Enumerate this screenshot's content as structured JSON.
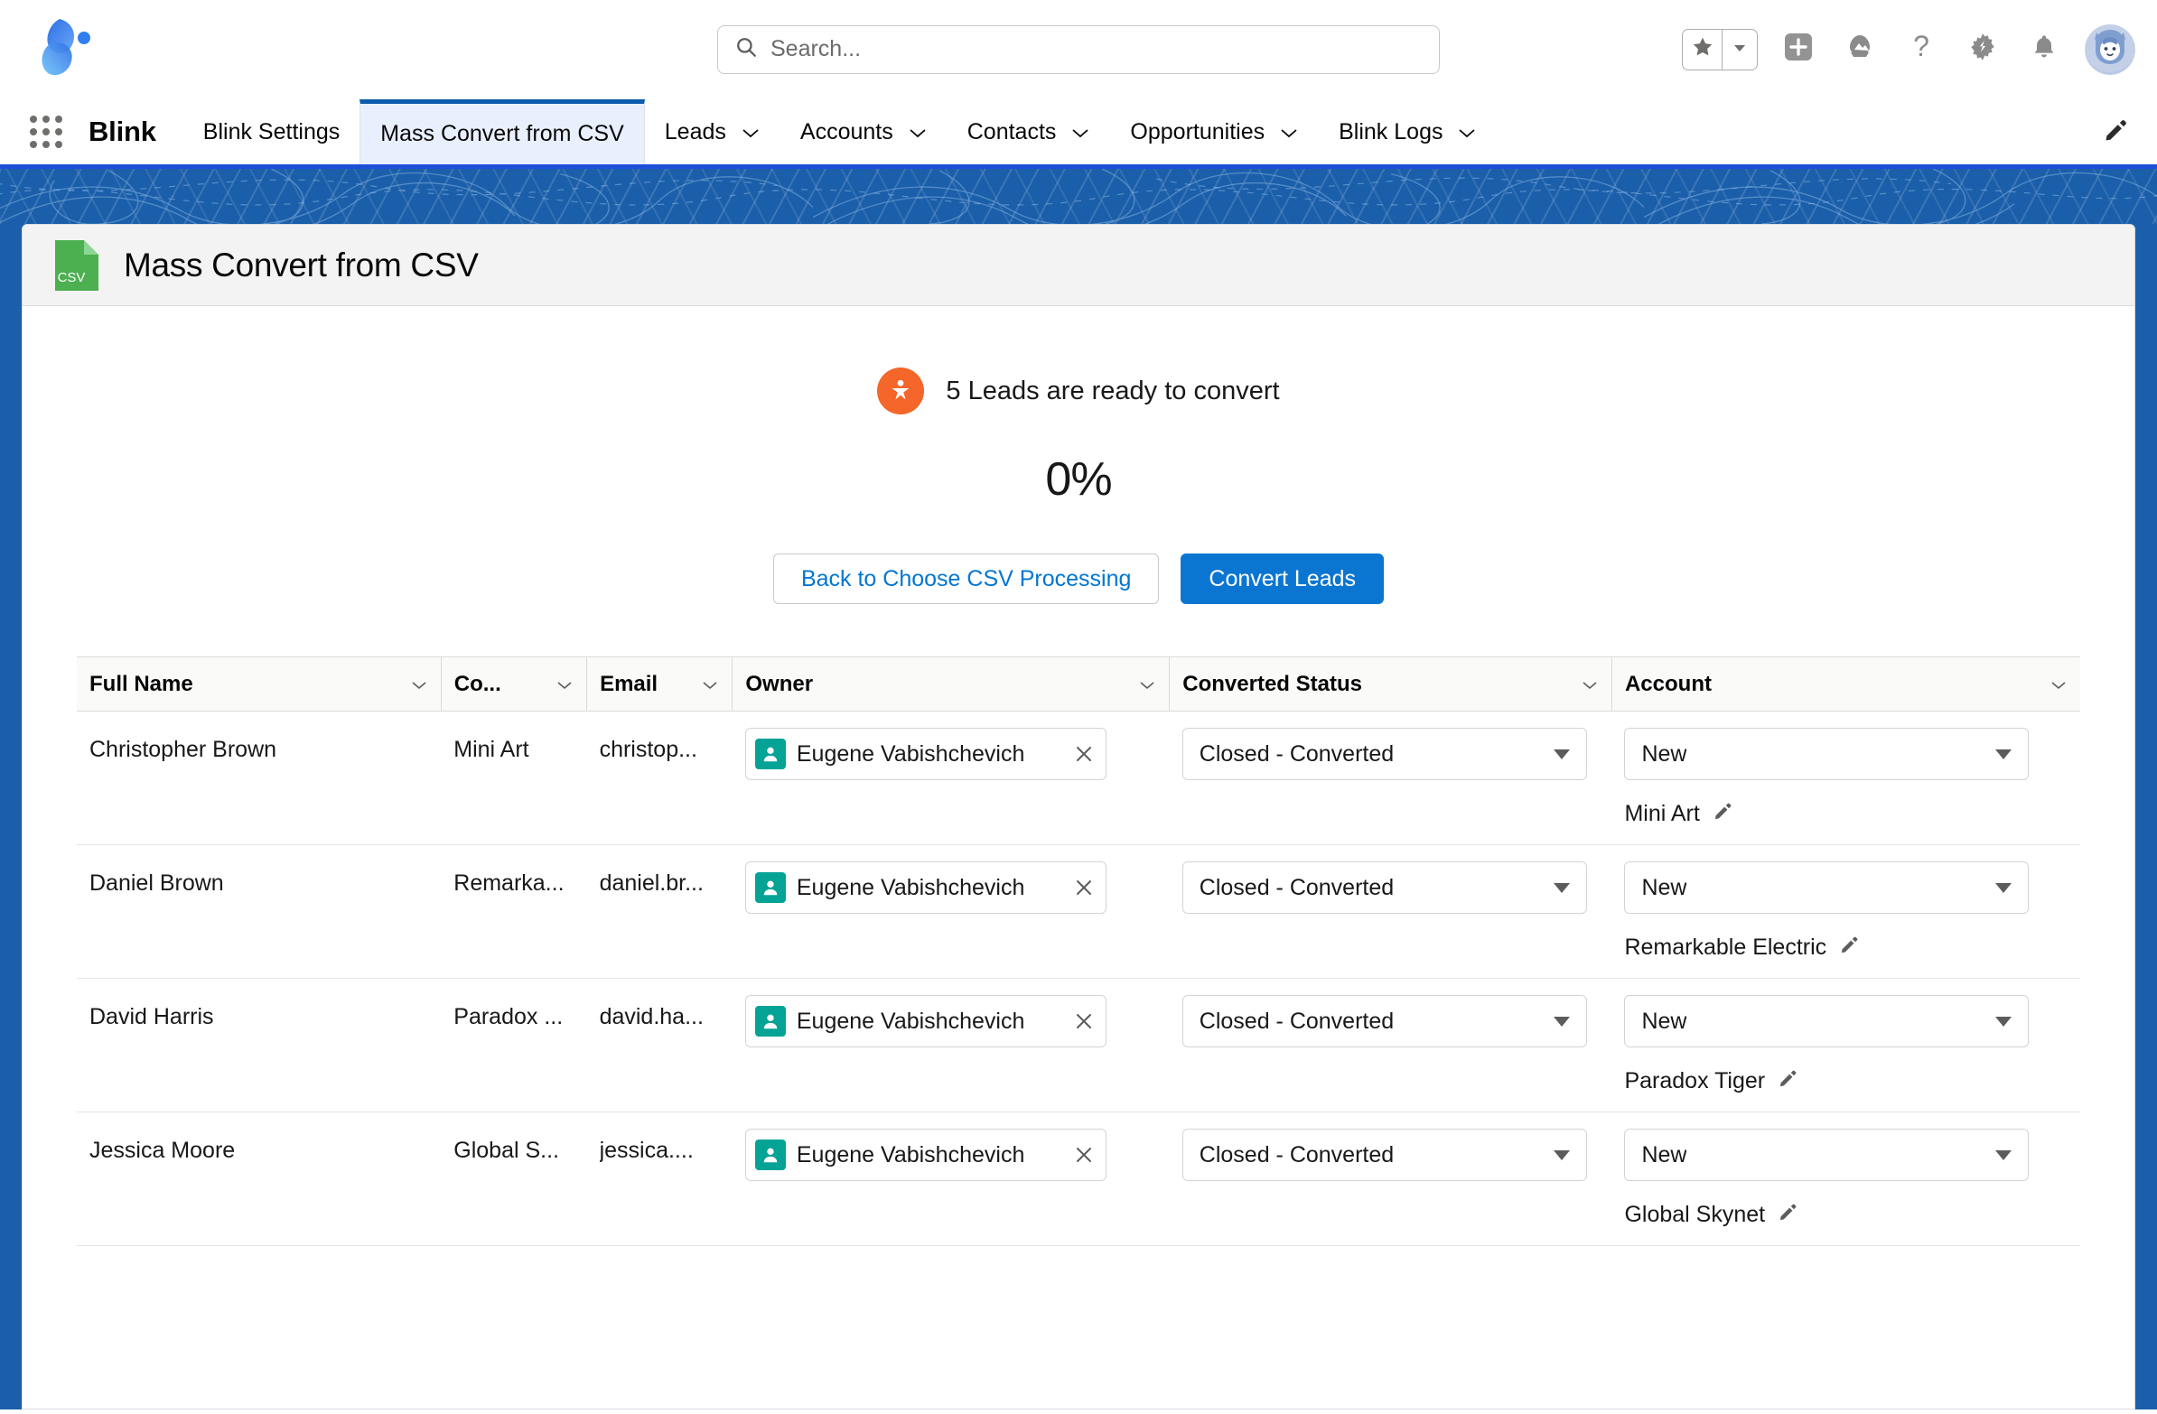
{
  "header": {
    "app_logo_name": "blink-logo",
    "search": {
      "placeholder": "Search...",
      "value": ""
    },
    "actions": [
      {
        "name": "favorites-button",
        "icon": "star-icon"
      },
      {
        "name": "favorites-dropdown",
        "icon": "chevron-down-icon"
      },
      {
        "name": "global-actions-button",
        "icon": "plus-icon"
      },
      {
        "name": "app-launcher-button",
        "icon": "mountain-icon"
      },
      {
        "name": "help-button",
        "icon": "question-icon"
      },
      {
        "name": "setup-button",
        "icon": "gear-icon"
      },
      {
        "name": "notifications-button",
        "icon": "bell-icon"
      },
      {
        "name": "user-profile-button",
        "icon": "avatar-icon"
      }
    ]
  },
  "nav": {
    "app_name": "Blink",
    "items": [
      {
        "label": "Blink Settings",
        "has_caret": false,
        "active": false
      },
      {
        "label": "Mass Convert from CSV",
        "has_caret": false,
        "active": true
      },
      {
        "label": "Leads",
        "has_caret": true,
        "active": false
      },
      {
        "label": "Accounts",
        "has_caret": true,
        "active": false
      },
      {
        "label": "Contacts",
        "has_caret": true,
        "active": false
      },
      {
        "label": "Opportunities",
        "has_caret": true,
        "active": false
      },
      {
        "label": "Blink Logs",
        "has_caret": true,
        "active": false
      }
    ],
    "edit_icon": "pencil-icon"
  },
  "page": {
    "icon": "csv-file-icon",
    "icon_text": "CSV",
    "title": "Mass Convert from CSV",
    "status_text": "5 Leads are ready to convert",
    "status_icon": "lead-icon",
    "progress_percent": "0%",
    "buttons": {
      "back": "Back to Choose CSV Processing",
      "convert": "Convert Leads"
    }
  },
  "colors": {
    "brand_blue": "#0b76d1",
    "link_blue": "#0176d3",
    "banner_blue": "#1b5faa",
    "lead_orange": "#f4662a",
    "csv_green": "#4caf50",
    "owner_teal": "#04a396"
  },
  "table": {
    "columns": [
      {
        "label": "Full Name",
        "has_caret": true
      },
      {
        "label": "Co...",
        "has_caret": true
      },
      {
        "label": "Email",
        "has_caret": true
      },
      {
        "label": "Owner",
        "has_caret": true
      },
      {
        "label": "Converted Status",
        "has_caret": true
      },
      {
        "label": "Account",
        "has_caret": true
      }
    ],
    "rows": [
      {
        "full_name": "Christopher Brown",
        "company": "Mini Art",
        "email": "christop...",
        "owner": "Eugene Vabishchevich",
        "converted_status": "Closed - Converted",
        "account_action": "New",
        "account_name": "Mini Art"
      },
      {
        "full_name": "Daniel Brown",
        "company": "Remarka...",
        "email": "daniel.br...",
        "owner": "Eugene Vabishchevich",
        "converted_status": "Closed - Converted",
        "account_action": "New",
        "account_name": "Remarkable Electric"
      },
      {
        "full_name": "David Harris",
        "company": "Paradox ...",
        "email": "david.ha...",
        "owner": "Eugene Vabishchevich",
        "converted_status": "Closed - Converted",
        "account_action": "New",
        "account_name": "Paradox Tiger"
      },
      {
        "full_name": "Jessica Moore",
        "company": "Global S...",
        "email": "jessica....",
        "owner": "Eugene Vabishchevich",
        "converted_status": "Closed - Converted",
        "account_action": "New",
        "account_name": "Global Skynet"
      }
    ]
  }
}
